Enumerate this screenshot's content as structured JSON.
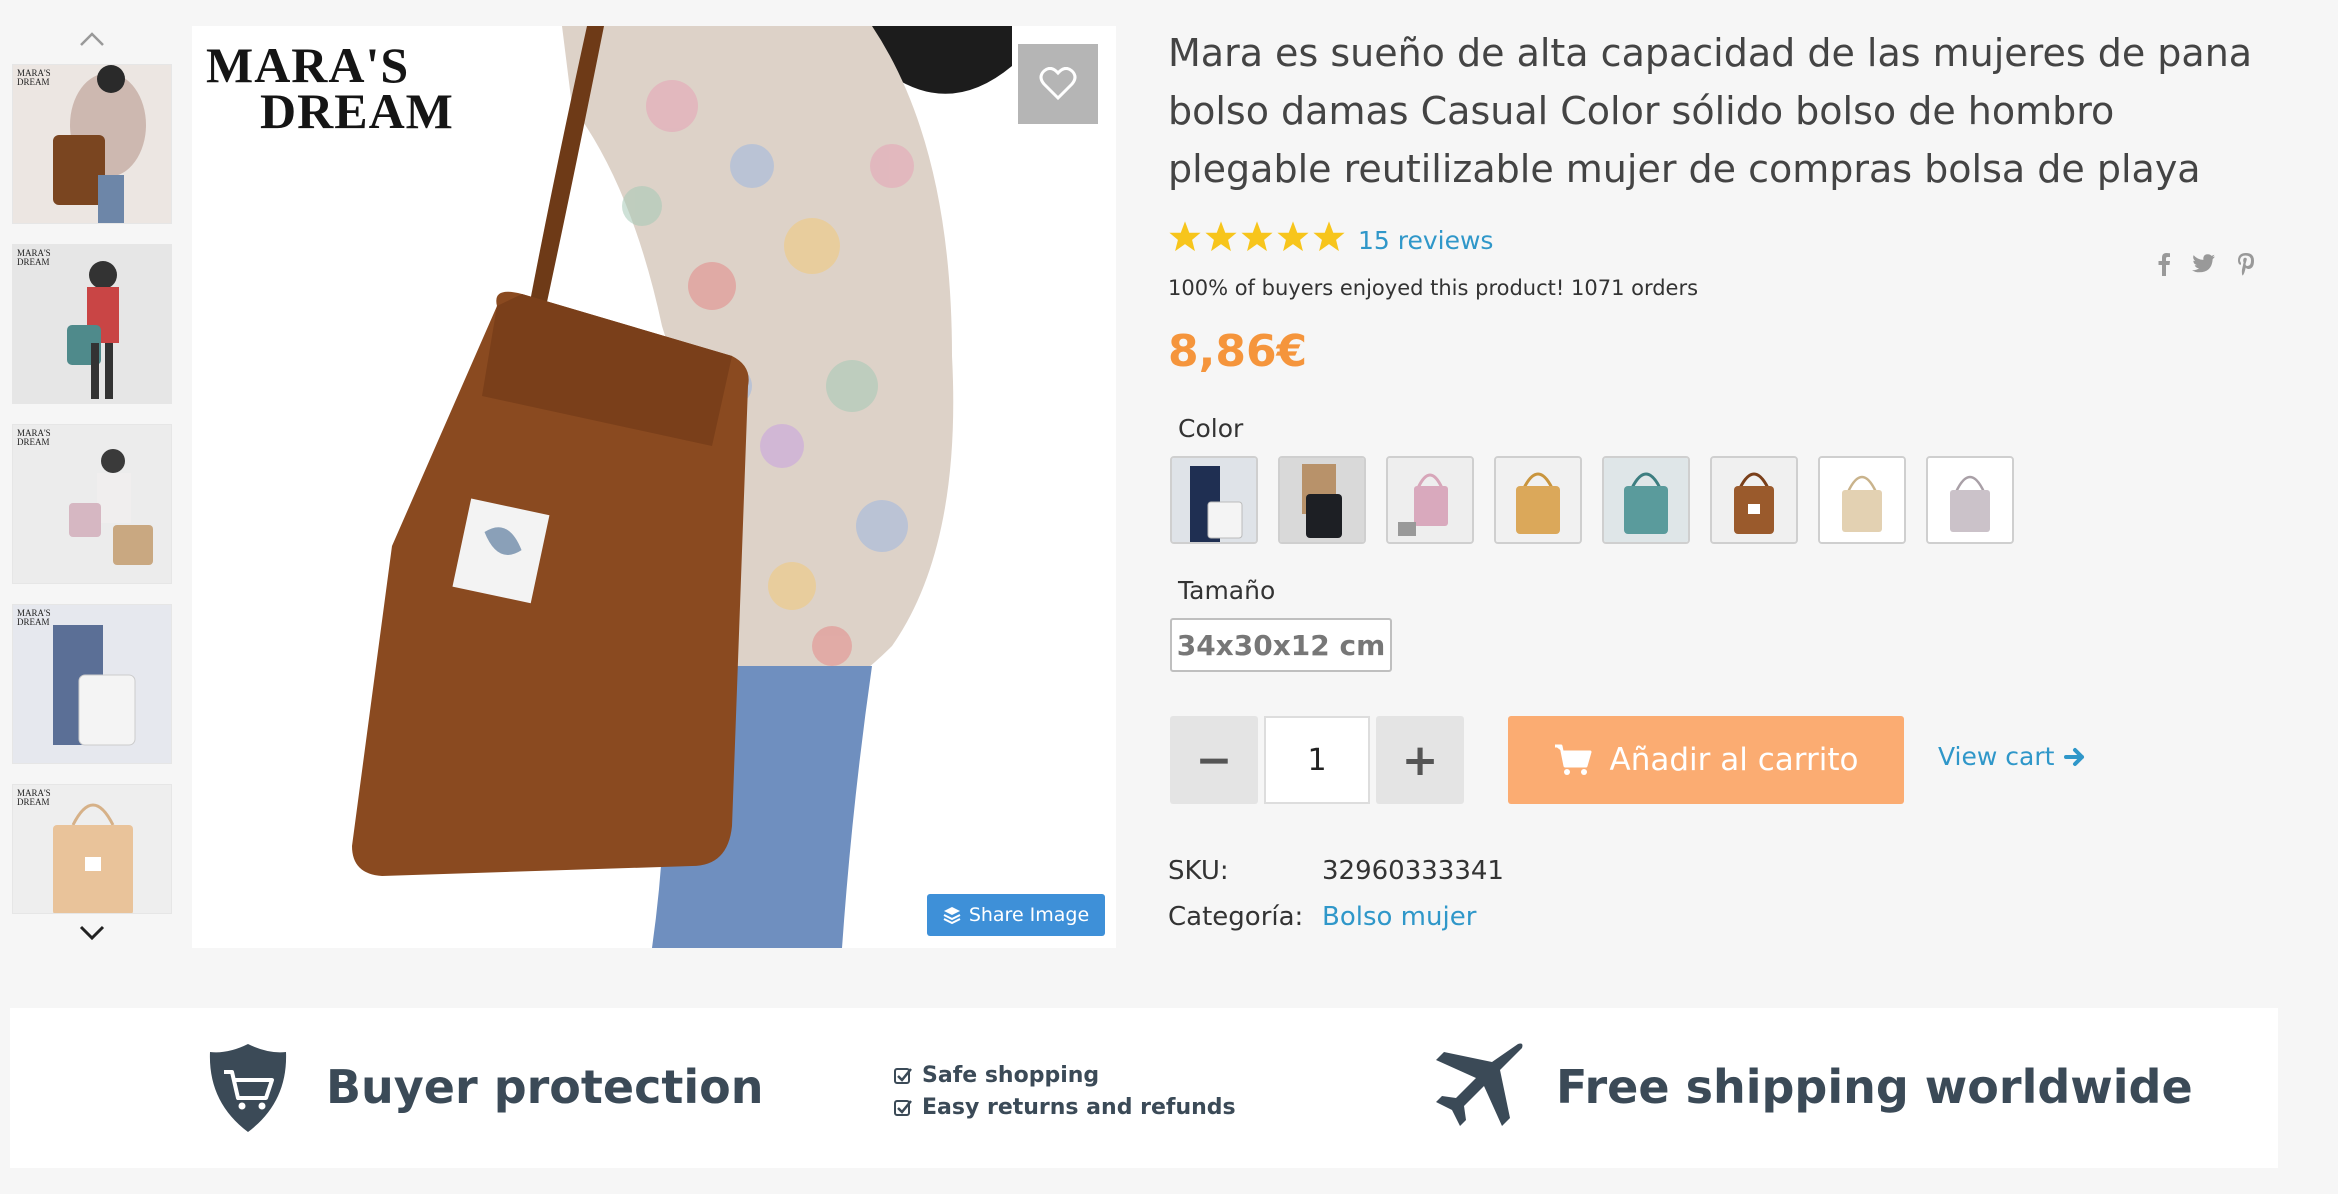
{
  "brand": {
    "line1": "MARA'S",
    "line2": "DREAM"
  },
  "product": {
    "title": "Mara es sueño de alta capacidad de las mujeres de pana bolso damas Casual Color sólido bolso de hombro plegable reutilizable mujer de compras bolsa de playa",
    "rating_stars": 5,
    "reviews_label": "15 reviews",
    "enjoy_text": "100% of buyers enjoyed this product! 1071 orders",
    "price": "8,86€",
    "accent_color": "#f5953c",
    "link_color": "#2f97c9"
  },
  "gallery": {
    "thumbnail_count": 5,
    "up_icon": "chevron-up-icon",
    "down_icon": "chevron-down-icon",
    "favorite_icon": "heart-icon",
    "share_label": "Share Image",
    "share_icon": "layers-icon"
  },
  "social": [
    "facebook-icon",
    "twitter-icon",
    "pinterest-icon"
  ],
  "options": {
    "color_label": "Color",
    "color_swatches": [
      "navy",
      "black",
      "pink",
      "mustard",
      "teal",
      "brown",
      "beige",
      "grey"
    ],
    "size_label": "Tamaño",
    "size_value": "34x30x12 cm"
  },
  "cart": {
    "quantity": "1",
    "minus_label": "−",
    "plus_label": "+",
    "add_label": "Añadir al carrito",
    "cart_icon": "cart-icon",
    "view_cart_label": "View cart",
    "view_cart_icon": "arrow-right-icon"
  },
  "meta": {
    "sku_key": "SKU:",
    "sku_value": "32960333341",
    "category_key": "Categoría:",
    "category_value": "Bolso mujer"
  },
  "banner": {
    "buyer_protection": "Buyer protection",
    "check1": "Safe shopping",
    "check2": "Easy returns and refunds",
    "free_shipping": "Free shipping worldwide"
  }
}
